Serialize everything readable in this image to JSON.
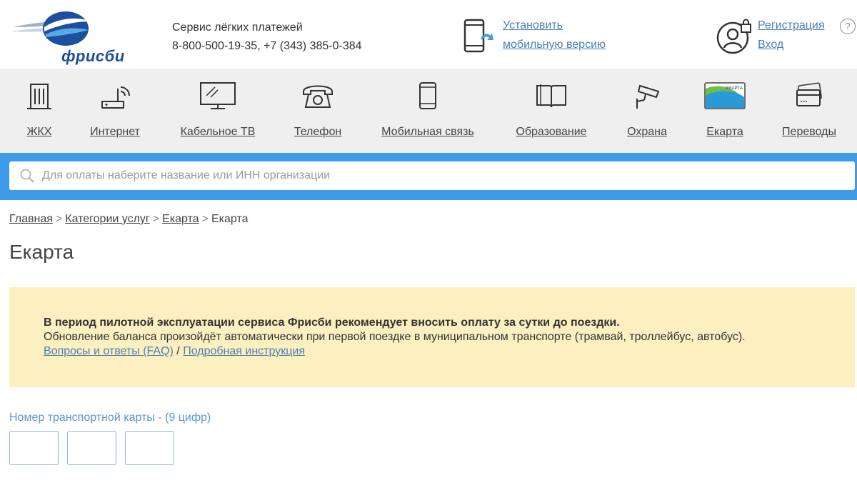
{
  "header": {
    "logo_text": "фрисби",
    "service_title": "Сервис лёгких платежей",
    "phones": "8-800-500-19-35, +7 (343) 385-0-384",
    "install_line1": "Установить",
    "install_line2": "мобильную версию",
    "register": "Регистрация",
    "login": "Вход",
    "help": "?"
  },
  "categories": [
    {
      "label": "ЖКХ",
      "icon": "building-icon"
    },
    {
      "label": "Интернет",
      "icon": "router-icon"
    },
    {
      "label": "Кабельное ТВ",
      "icon": "tv-icon"
    },
    {
      "label": "Телефон",
      "icon": "telephone-icon"
    },
    {
      "label": "Мобильная связь",
      "icon": "mobile-phone-icon"
    },
    {
      "label": "Образование",
      "icon": "book-icon"
    },
    {
      "label": "Охрана",
      "icon": "security-camera-icon"
    },
    {
      "label": "Екарта",
      "icon": "ekarta-card-icon"
    },
    {
      "label": "Переводы",
      "icon": "credit-card-icon"
    }
  ],
  "search": {
    "placeholder": "Для оплаты наберите название или ИНН организации"
  },
  "breadcrumb": {
    "home": "Главная",
    "categories": "Категории услуг",
    "ekarta": "Екарта",
    "current": "Екарта",
    "separator": ">"
  },
  "page_title": "Екарта",
  "notice": {
    "bold": "В период пилотной эксплуатации сервиса Фрисби рекомендует вносить оплату за сутки до поездки.",
    "text": "Обновление баланса произойдёт автоматически при первой поездке в муниципальном транспорте (трамвай, троллейбус, автобус).",
    "faq": "Вопросы и ответы (FAQ)",
    "slash": " / ",
    "instruction": "Подробная инструкция"
  },
  "card_label": "Номер транспортной карты - (9 цифр)",
  "ekarta_card_text": "ЕКАРТА",
  "colors": {
    "accent_blue": "#3d9be9",
    "link": "#4a7fb5",
    "notice_bg": "#fcefc0"
  }
}
